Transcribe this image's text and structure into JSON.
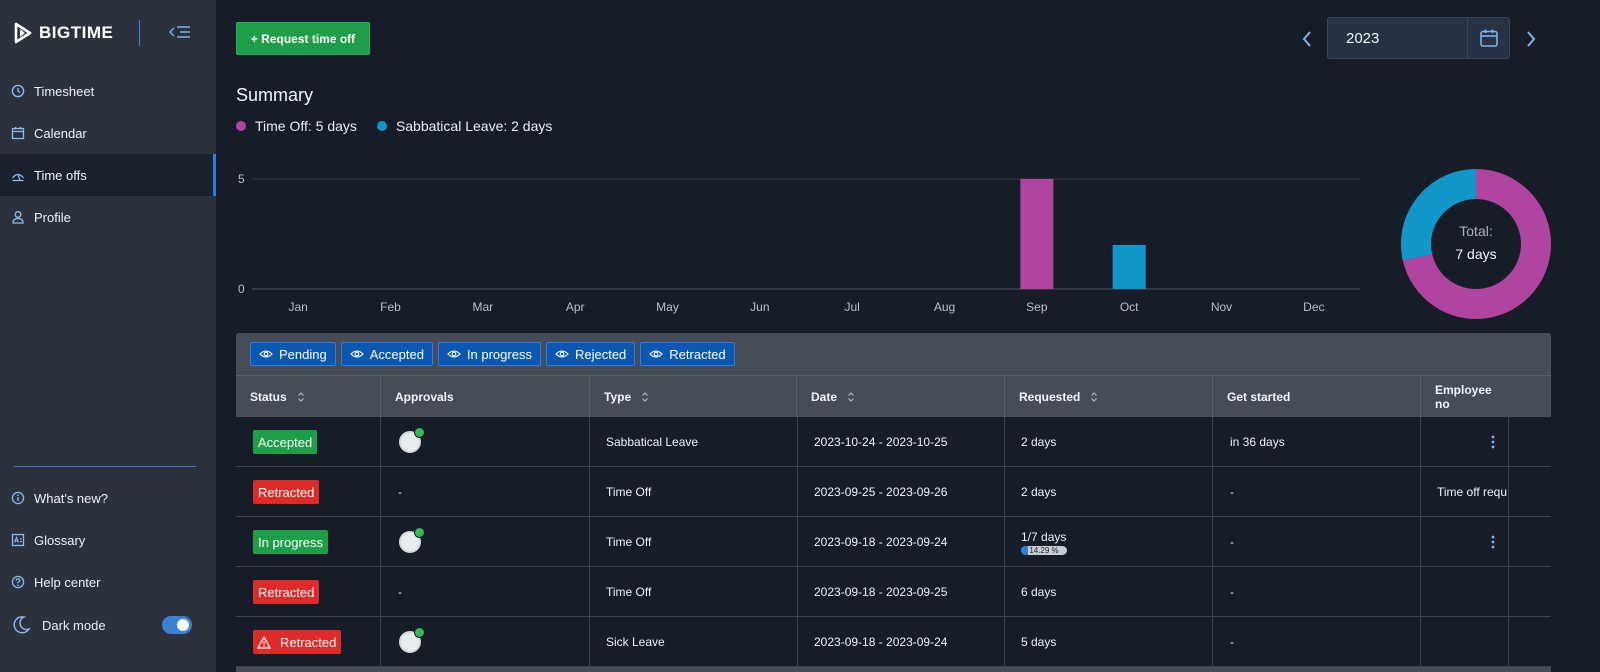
{
  "app": {
    "logo_text": "BIGTIME"
  },
  "sidebar": {
    "items": [
      {
        "label": "Timesheet",
        "icon": "clock-icon",
        "active": false
      },
      {
        "label": "Calendar",
        "icon": "calendar-icon",
        "active": false
      },
      {
        "label": "Time offs",
        "icon": "time-offs-icon",
        "active": true
      },
      {
        "label": "Profile",
        "icon": "person-icon",
        "active": false
      }
    ],
    "bottom_items": [
      {
        "label": "What's new?",
        "icon": "info-icon"
      },
      {
        "label": "Glossary",
        "icon": "glossary-icon"
      },
      {
        "label": "Help center",
        "icon": "help-icon"
      }
    ],
    "dark_mode": {
      "label": "Dark mode",
      "enabled": true
    }
  },
  "header": {
    "request_button": "+ Request time off",
    "year": "2023"
  },
  "summary": {
    "title": "Summary",
    "legend": [
      {
        "label": "Time Off: 5 days",
        "color": "#b0459f"
      },
      {
        "label": "Sabbatical Leave: 2 days",
        "color": "#1297c9"
      }
    ]
  },
  "chart_data": [
    {
      "type": "bar",
      "categories": [
        "Jan",
        "Feb",
        "Mar",
        "Apr",
        "May",
        "Jun",
        "Jul",
        "Aug",
        "Sep",
        "Oct",
        "Nov",
        "Dec"
      ],
      "series": [
        {
          "name": "Time Off",
          "color": "#b0459f",
          "values": [
            0,
            0,
            0,
            0,
            0,
            0,
            0,
            0,
            5,
            0,
            0,
            0
          ]
        },
        {
          "name": "Sabbatical Leave",
          "color": "#1297c9",
          "values": [
            0,
            0,
            0,
            0,
            0,
            0,
            0,
            0,
            0,
            2,
            0,
            0
          ]
        }
      ],
      "ytick_labels": [
        "0",
        "5"
      ],
      "ylim": [
        0,
        5
      ],
      "grid": true
    },
    {
      "type": "pie",
      "labels": [
        "Time Off",
        "Sabbatical Leave"
      ],
      "values": [
        5,
        2
      ],
      "colors": [
        "#b0459f",
        "#1297c9"
      ],
      "center_label": "Total:",
      "center_value": "7 days"
    }
  ],
  "table": {
    "filters": [
      "Pending",
      "Accepted",
      "In progress",
      "Rejected",
      "Retracted"
    ],
    "columns": [
      {
        "label": "Status",
        "sortable": true
      },
      {
        "label": "Approvals",
        "sortable": false
      },
      {
        "label": "Type",
        "sortable": true
      },
      {
        "label": "Date",
        "sortable": true
      },
      {
        "label": "Requested",
        "sortable": true
      },
      {
        "label": "Get started",
        "sortable": false
      },
      {
        "label": "Employee no",
        "sortable": false
      }
    ],
    "rows": [
      {
        "status": "Accepted",
        "status_color": "green",
        "warning": false,
        "approval": true,
        "type": "Sabbatical Leave",
        "date": "2023-10-24 - 2023-10-25",
        "requested": "2 days",
        "progress": null,
        "get_started": "in 36 days",
        "note": "",
        "menu": true
      },
      {
        "status": "Retracted",
        "status_color": "red",
        "warning": false,
        "approval": false,
        "approval_text": "-",
        "type": "Time Off",
        "date": "2023-09-25 - 2023-09-26",
        "requested": "2 days",
        "progress": null,
        "get_started": "-",
        "note": "Time off requ",
        "menu": false
      },
      {
        "status": "In progress",
        "status_color": "green",
        "warning": false,
        "approval": true,
        "type": "Time Off",
        "date": "2023-09-18 - 2023-09-24",
        "requested": "1/7 days",
        "progress": {
          "value": 14.29,
          "label": "14.29 %"
        },
        "get_started": "-",
        "note": "",
        "menu": true
      },
      {
        "status": "Retracted",
        "status_color": "red",
        "warning": false,
        "approval": false,
        "approval_text": "-",
        "type": "Time Off",
        "date": "2023-09-18 - 2023-09-25",
        "requested": "6 days",
        "progress": null,
        "get_started": "-",
        "note": "",
        "menu": false
      },
      {
        "status": "Retracted",
        "status_color": "red",
        "warning": true,
        "approval": true,
        "type": "Sick Leave",
        "date": "2023-09-18 - 2023-09-24",
        "requested": "5 days",
        "progress": null,
        "get_started": "-",
        "note": "",
        "menu": false
      }
    ]
  }
}
